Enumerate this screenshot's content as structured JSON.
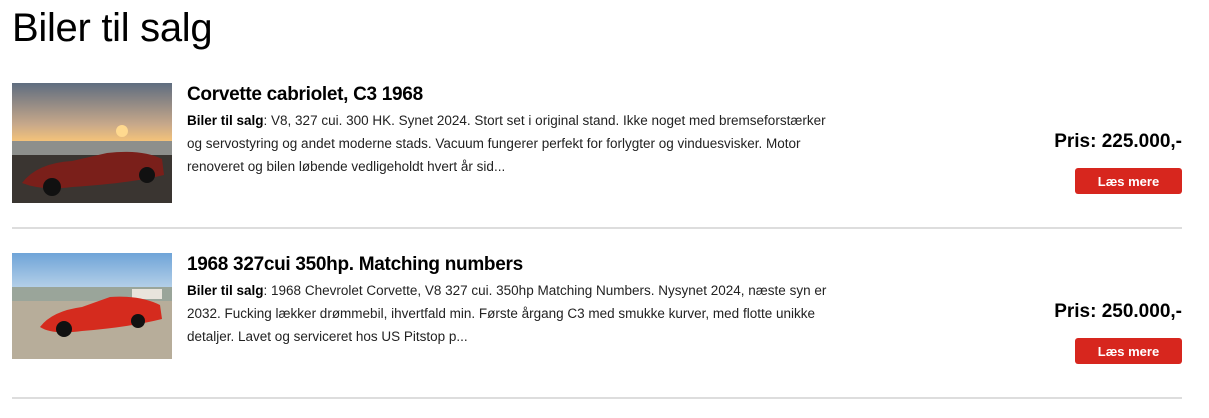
{
  "page": {
    "title": "Biler til salg"
  },
  "listings": [
    {
      "title": "Corvette cabriolet, C3 1968",
      "category": "Biler til salg",
      "description": ": V8, 327 cui. 300 HK. Synet 2024. Stort set i original stand. Ikke noget med bremseforstærker og servostyring og andet moderne stads. Vacuum fungerer perfekt for forlygter og vinduesvisker. Motor renoveret og bilen løbende vedligeholdt hvert år sid...",
      "price": "Pris: 225.000,-",
      "button_label": "Læs mere",
      "car_color": "#7a1f1a"
    },
    {
      "title": "1968 327cui 350hp. Matching numbers",
      "category": "Biler til salg",
      "description": ": 1968 Chevrolet Corvette, V8 327 cui. 350hp Matching Numbers. Nysynet 2024, næste syn er 2032. Fucking lækker drømmebil, ihvertfald min. Første årgang C3 med smukke kurver, med flotte unikke detaljer. Lavet og serviceret hos US Pitstop p...",
      "price": "Pris: 250.000,-",
      "button_label": "Læs mere",
      "car_color": "#d52b1e"
    }
  ]
}
